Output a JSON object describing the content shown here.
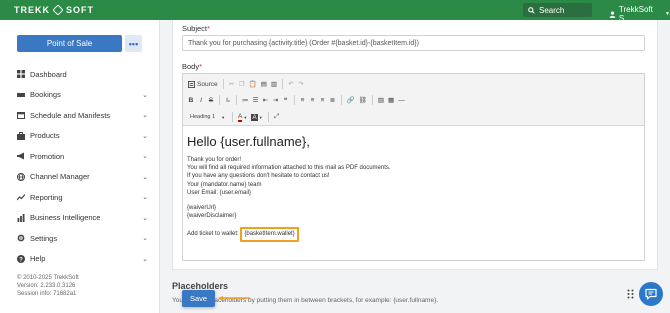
{
  "topbar": {
    "logo_left": "TREKK",
    "logo_right": "SOFT",
    "search_label": "Search",
    "user_name": "TrekkSoft S."
  },
  "sidebar": {
    "pos_label": "Point of Sale",
    "more_label": "•••",
    "items": [
      {
        "label": "Dashboard",
        "icon": "dashboard-icon",
        "chevron": false
      },
      {
        "label": "Bookings",
        "icon": "bookings-icon",
        "chevron": true
      },
      {
        "label": "Schedule and Manifests",
        "icon": "schedule-icon",
        "chevron": true
      },
      {
        "label": "Products",
        "icon": "products-icon",
        "chevron": true
      },
      {
        "label": "Promotion",
        "icon": "promotion-icon",
        "chevron": true
      },
      {
        "label": "Channel Manager",
        "icon": "channel-manager-icon",
        "chevron": true
      },
      {
        "label": "Reporting",
        "icon": "reporting-icon",
        "chevron": true
      },
      {
        "label": "Business Intelligence",
        "icon": "business-intelligence-icon",
        "chevron": true
      },
      {
        "label": "Settings",
        "icon": "settings-icon",
        "chevron": true
      },
      {
        "label": "Help",
        "icon": "help-icon",
        "chevron": true
      }
    ],
    "footer": {
      "copyright": "© 2010-2025 TrekkSoft",
      "version": "Version: 2.233.0.3126",
      "session": "Session info: 71682a1"
    }
  },
  "form": {
    "subject_label": "Subject",
    "subject_value": "Thank you for purchasing {activity.title} (Order #{basket.id}-{basketItem.id})",
    "body_label": "Body",
    "required_mark": "*"
  },
  "editor": {
    "source_label": "Source",
    "format_label": "Heading 1",
    "content": {
      "heading": "Hello {user.fullname},",
      "lines": [
        "Thank you for order!",
        "You will find all required information attached to this mail as PDF documents.",
        "If you have any questions don't hesitate to contact us!",
        "Your {mandator.name} team",
        "User Email: {user.email}"
      ],
      "lines2": [
        "{waiverUrl}",
        "{waiverDisclaimer}"
      ],
      "ticket_prefix": "Add ticket to wallet: ",
      "ticket_placeholder": "{basketItem.wallet}"
    }
  },
  "bottom": {
    "placeholders_title": "Placeholders",
    "placeholders_desc": "You can use placeholders by putting them in between brackets, for example: {user.fullname}.",
    "save_label": "Save"
  },
  "colors": {
    "brand_green": "#2c8a47",
    "primary_blue": "#3a78c4",
    "highlight_orange": "#f0a020"
  }
}
